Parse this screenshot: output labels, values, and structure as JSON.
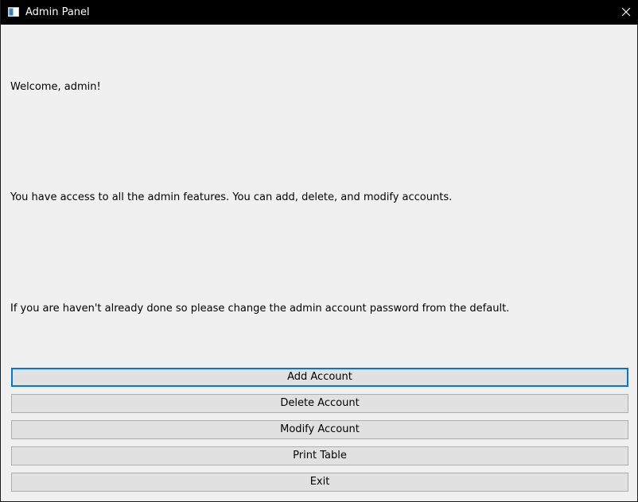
{
  "window": {
    "title": "Admin Panel",
    "close_icon": "close-icon",
    "app_icon": "window-app-icon"
  },
  "content": {
    "welcome": "Welcome, admin!",
    "access_info": "You have access to all the admin features. You can add, delete, and modify accounts.",
    "password_notice": "If you are haven't already done so please change the admin account password from the default."
  },
  "buttons": {
    "add": "Add Account",
    "delete": "Delete Account",
    "modify": "Modify Account",
    "print": "Print Table",
    "exit": "Exit"
  },
  "colors": {
    "titlebar": "#000000",
    "window_bg": "#f0f0f0",
    "button_bg": "#e1e1e1",
    "button_border": "#adadad",
    "focus_border": "#0078d7"
  }
}
